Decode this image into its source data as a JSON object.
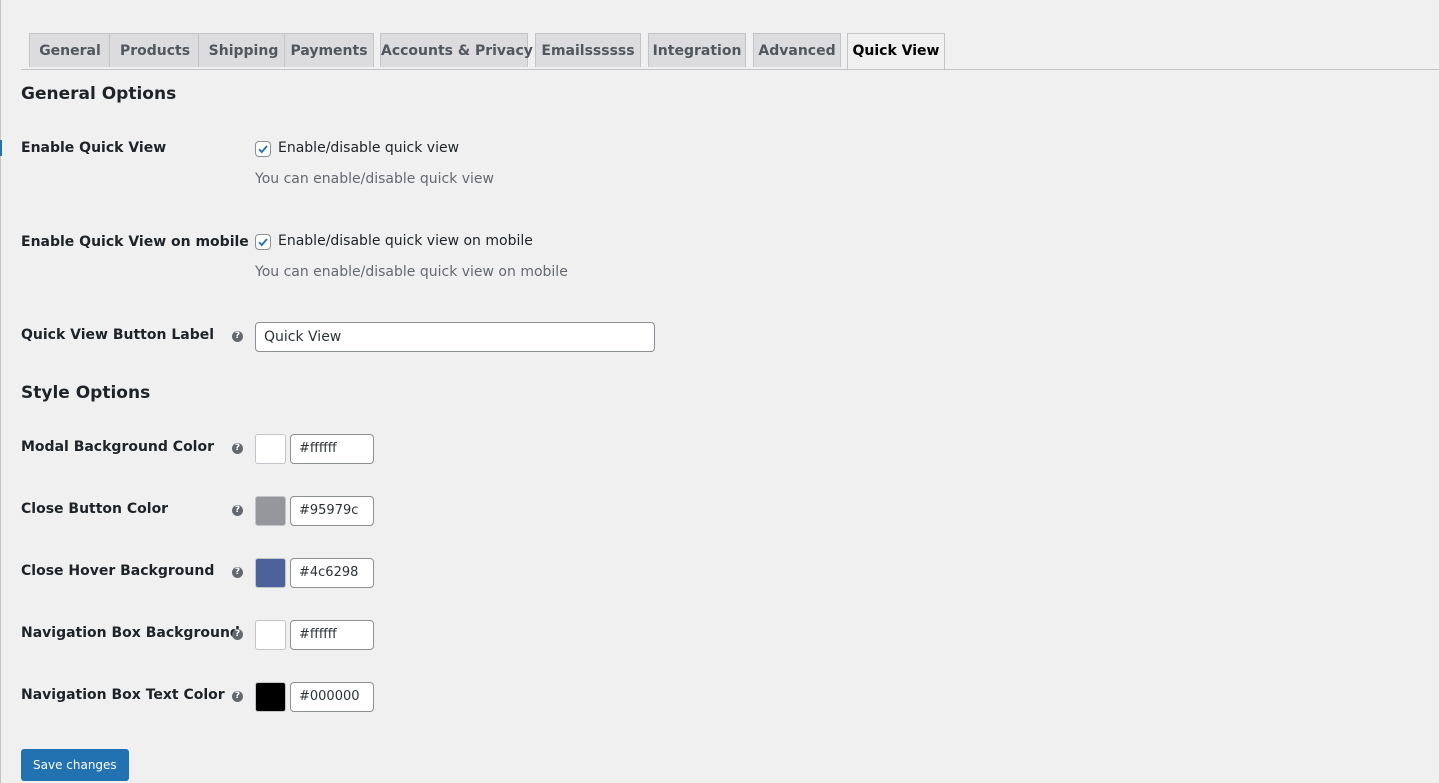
{
  "tabs": [
    {
      "label": "General",
      "active": false
    },
    {
      "label": "Products",
      "active": false
    },
    {
      "label": "Shipping",
      "active": false
    },
    {
      "label": "Payments",
      "active": false
    },
    {
      "label": "Accounts & Privacy",
      "active": false
    },
    {
      "label": "Emailssssss",
      "active": false
    },
    {
      "label": "Integration",
      "active": false
    },
    {
      "label": "Advanced",
      "active": false
    },
    {
      "label": "Quick View",
      "active": true
    }
  ],
  "general_options": {
    "title": "General Options",
    "enable_quick_view": {
      "label": "Enable Quick View",
      "checked": true,
      "checkbox_label": "Enable/disable quick view",
      "description": "You can enable/disable quick view"
    },
    "enable_quick_view_mobile": {
      "label": "Enable Quick View on mobile",
      "checked": true,
      "checkbox_label": "Enable/disable quick view on mobile",
      "description": "You can enable/disable quick view on mobile"
    },
    "button_label": {
      "label": "Quick View Button Label",
      "value": "Quick View",
      "help_icon": "question-circle-icon"
    }
  },
  "style_options": {
    "title": "Style Options",
    "fields": [
      {
        "label": "Modal Background Color",
        "value": "#ffffff",
        "swatch": "#ffffff"
      },
      {
        "label": "Close Button Color",
        "value": "#95979c",
        "swatch": "#95979c"
      },
      {
        "label": "Close Hover Background",
        "value": "#4c6298",
        "swatch": "#4c6298"
      },
      {
        "label": "Navigation Box Background",
        "value": "#ffffff",
        "swatch": "#ffffff"
      },
      {
        "label": "Navigation Box Text Color",
        "value": "#000000",
        "swatch": "#000000"
      }
    ]
  },
  "save_button": {
    "label": "Save changes"
  },
  "colors": {
    "accent": "#2271b1",
    "page_background": "#f0f0f1",
    "tab_inactive": "#dcdcde"
  }
}
